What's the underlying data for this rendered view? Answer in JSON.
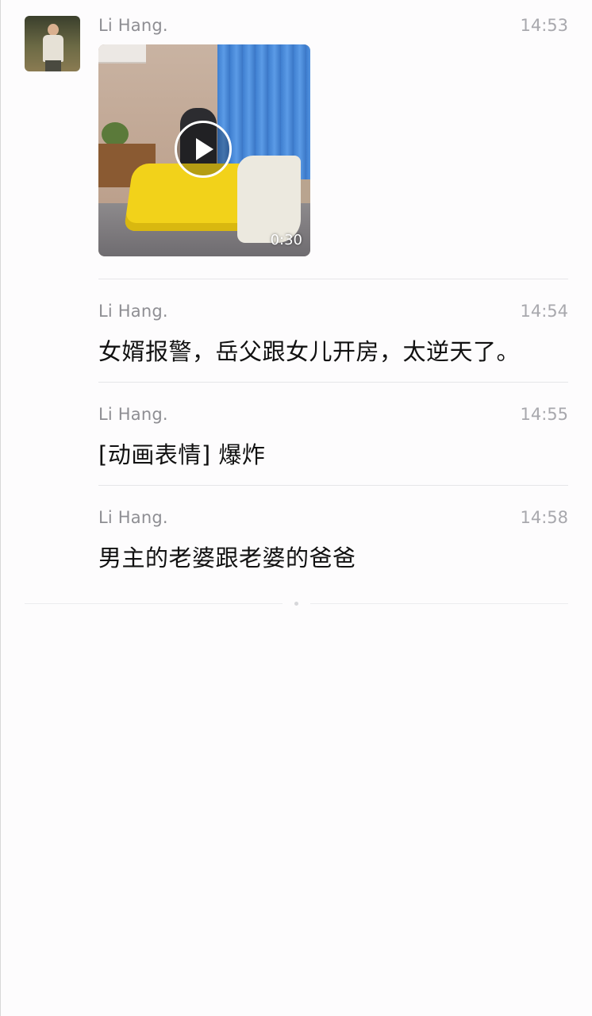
{
  "chat": {
    "messages": [
      {
        "sender": "Li Hang.",
        "time": "14:53",
        "type": "video",
        "video_duration": "0:30"
      },
      {
        "sender": "Li Hang.",
        "time": "14:54",
        "type": "text",
        "text": "女婿报警，岳父跟女儿开房，太逆天了。"
      },
      {
        "sender": "Li Hang.",
        "time": "14:55",
        "type": "text",
        "text": "[动画表情] 爆炸"
      },
      {
        "sender": "Li Hang.",
        "time": "14:58",
        "type": "text",
        "text": "男主的老婆跟老婆的爸爸"
      }
    ]
  },
  "icons": {
    "play": "play-icon",
    "avatar": "avatar-image"
  },
  "colors": {
    "background": "#fdfcfd",
    "sender": "#8e8e93",
    "time": "#a8a8ad",
    "text": "#111111",
    "divider": "#e6e6e8"
  }
}
